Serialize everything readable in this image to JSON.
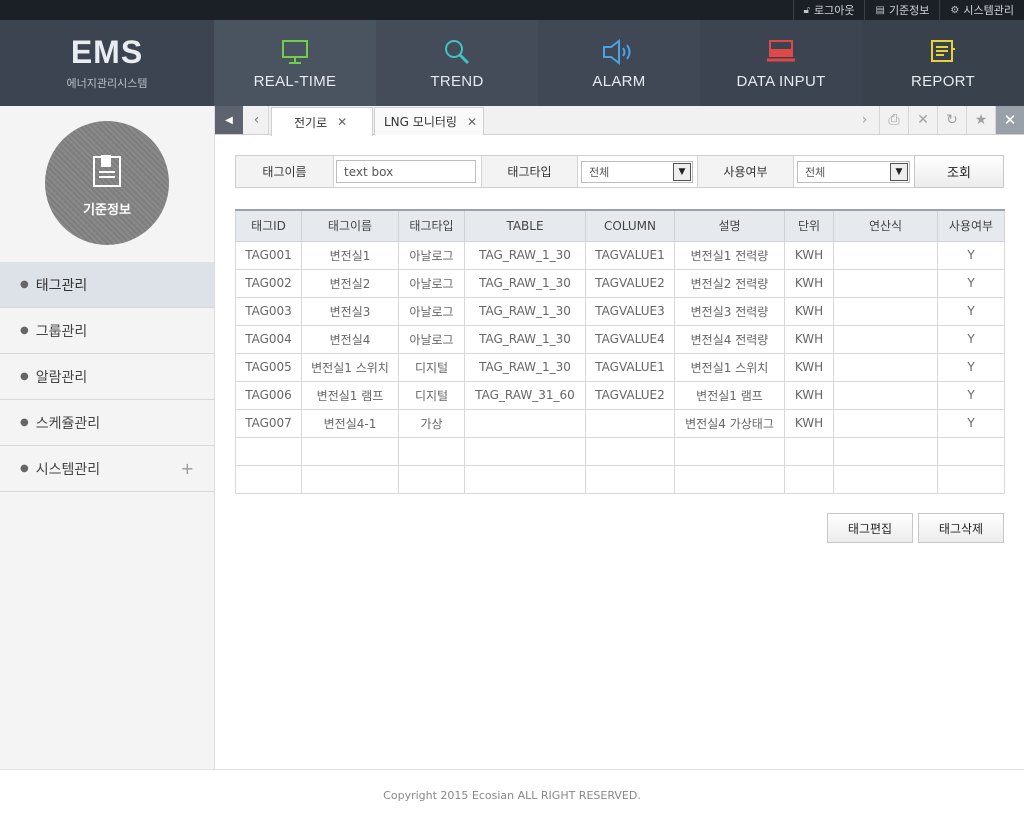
{
  "topbar": {
    "links": [
      {
        "icon": "lock-icon",
        "label": "로그아웃"
      },
      {
        "icon": "document-icon",
        "label": "기준정보"
      },
      {
        "icon": "gear-icon",
        "label": "시스템관리"
      }
    ]
  },
  "logo": {
    "title": "EMS",
    "subtitle": "에너지관리시스템"
  },
  "nav": [
    {
      "label": "REAL-TIME",
      "icon": "monitor-icon",
      "color": "#6fcf4a"
    },
    {
      "label": "TREND",
      "icon": "magnifier-icon",
      "color": "#3fc4c0"
    },
    {
      "label": "ALARM",
      "icon": "speaker-icon",
      "color": "#4aa3e8"
    },
    {
      "label": "DATA INPUT",
      "icon": "laptop-icon",
      "color": "#e04848"
    },
    {
      "label": "REPORT",
      "icon": "report-icon",
      "color": "#e6d23a"
    }
  ],
  "sidebar": {
    "section_title": "기준정보",
    "items": [
      {
        "label": "태그관리",
        "active": true
      },
      {
        "label": "그룹관리"
      },
      {
        "label": "알람관리"
      },
      {
        "label": "스케쥴관리"
      },
      {
        "label": "시스템관리",
        "expandable": true
      }
    ]
  },
  "tabs": [
    {
      "label": "전기로",
      "active": true
    },
    {
      "label": "LNG 모니터링"
    }
  ],
  "search": {
    "tag_name_label": "태그이름",
    "tag_name_value": "text box",
    "tag_type_label": "태그타입",
    "tag_type_value": "전체",
    "usage_label": "사용여부",
    "usage_value": "전체",
    "search_button": "조회"
  },
  "table": {
    "headers": [
      "태그ID",
      "태그이름",
      "태그타입",
      "TABLE",
      "COLUMN",
      "설명",
      "단위",
      "연산식",
      "사용여부"
    ],
    "rows": [
      [
        "TAG001",
        "변전실1",
        "아날로그",
        "TAG_RAW_1_30",
        "TAGVALUE1",
        "변전실1 전력량",
        "KWH",
        "",
        "Y"
      ],
      [
        "TAG002",
        "변전실2",
        "아날로그",
        "TAG_RAW_1_30",
        "TAGVALUE2",
        "변전실2 전력량",
        "KWH",
        "",
        "Y"
      ],
      [
        "TAG003",
        "변전실3",
        "아날로그",
        "TAG_RAW_1_30",
        "TAGVALUE3",
        "변전실3 전력량",
        "KWH",
        "",
        "Y"
      ],
      [
        "TAG004",
        "변전실4",
        "아날로그",
        "TAG_RAW_1_30",
        "TAGVALUE4",
        "변전실4 전력량",
        "KWH",
        "",
        "Y"
      ],
      [
        "TAG005",
        "변전실1 스위치",
        "디지털",
        "TAG_RAW_1_30",
        "TAGVALUE1",
        "변전실1 스위치",
        "KWH",
        "",
        "Y"
      ],
      [
        "TAG006",
        "변전실1 램프",
        "디지털",
        "TAG_RAW_31_60",
        "TAGVALUE2",
        "변전실1 램프",
        "KWH",
        "",
        "Y"
      ],
      [
        "TAG007",
        "변전실4-1",
        "가상",
        "",
        "",
        "변전실4 가상태그",
        "KWH",
        "",
        "Y"
      ],
      [
        "",
        "",
        "",
        "",
        "",
        "",
        "",
        "",
        ""
      ],
      [
        "",
        "",
        "",
        "",
        "",
        "",
        "",
        "",
        ""
      ]
    ]
  },
  "actions": {
    "edit": "태그편집",
    "delete": "태그삭제"
  },
  "footer": {
    "copyright": "Copyright 2015  Ecosian ALL RIGHT RESERVED."
  }
}
